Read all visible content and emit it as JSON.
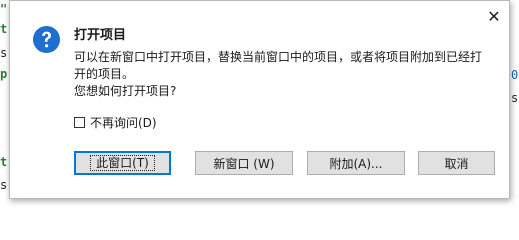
{
  "dialog": {
    "title": "打开项目",
    "message_lines": [
      "可以在新窗口中打开项目，替换当前窗口中的项目，或者将项目附加到已经打",
      "开的项目。",
      "您想如何打开项目?"
    ],
    "checkbox_label": "不再询问(D)",
    "checkbox_checked": false,
    "buttons": {
      "this_window": "此窗口(T)",
      "new_window": "新窗口 (W)",
      "attach": "附加(A)...",
      "cancel": "取消"
    },
    "close_glyph": "✕",
    "icon": "question-icon"
  },
  "background": {
    "left_chars": [
      "\"",
      "t",
      "s",
      "p",
      "t",
      "s"
    ],
    "right_chars": [
      "0",
      "s"
    ]
  },
  "colors": {
    "accent": "#0078d7",
    "icon_blue": "#1f6fd1",
    "left_fragment_green": "#2e7d32"
  }
}
